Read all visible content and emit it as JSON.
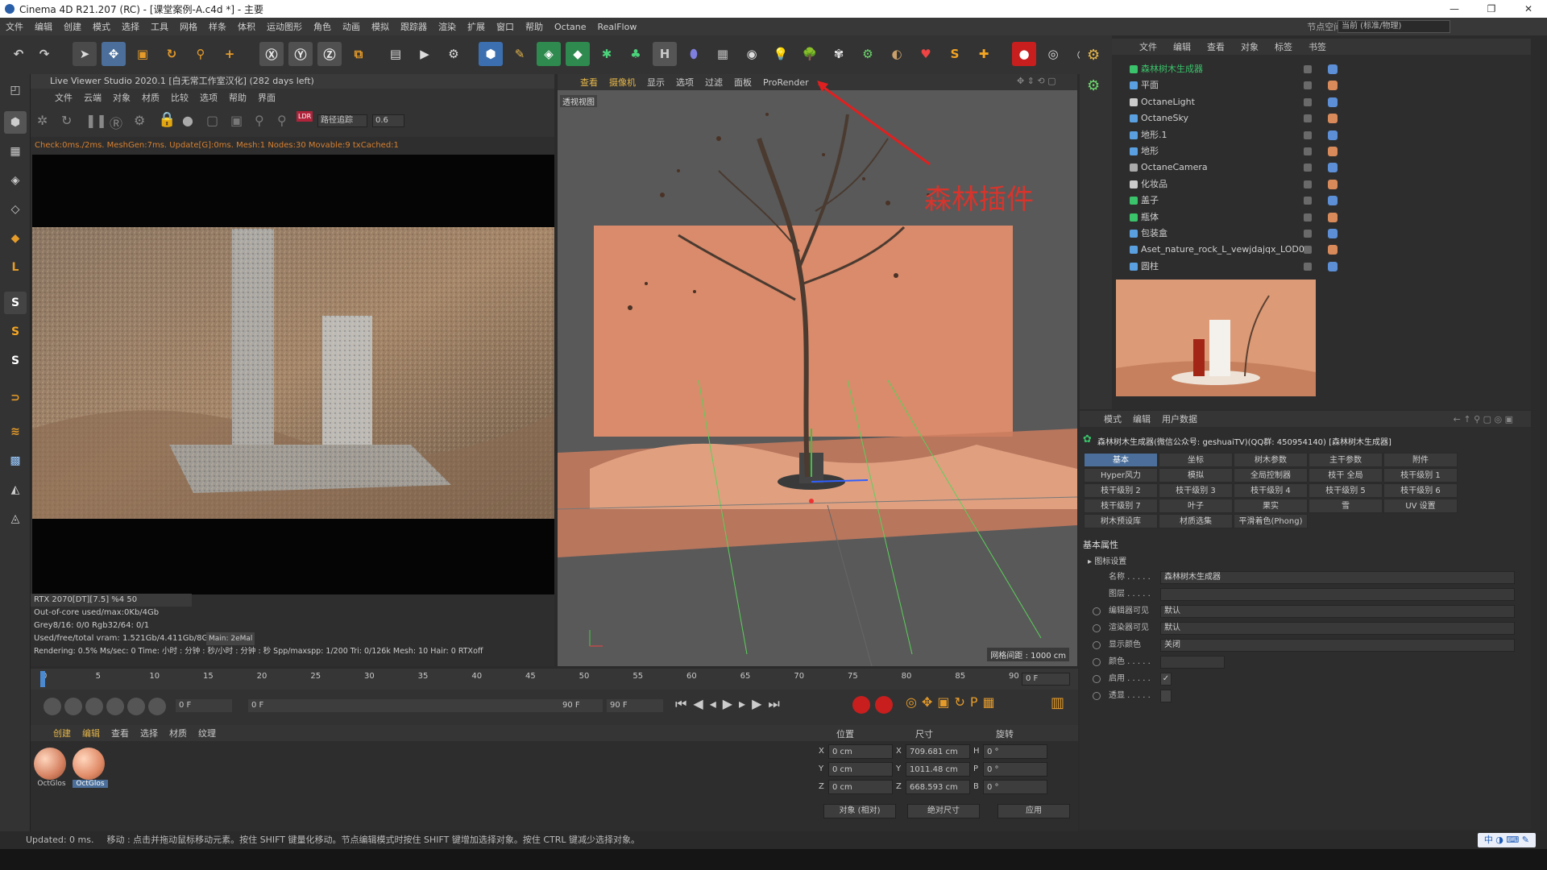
{
  "window": {
    "title": "Cinema 4D R21.207 (RC) - [课堂案例-A.c4d *] - 主要",
    "controls": [
      "—",
      "❐",
      "✕"
    ]
  },
  "menubar": {
    "items": [
      "文件",
      "编辑",
      "创建",
      "模式",
      "选择",
      "工具",
      "网格",
      "样条",
      "体积",
      "运动图形",
      "角色",
      "动画",
      "模拟",
      "跟踪器",
      "渲染",
      "扩展",
      "窗口",
      "帮助",
      "Octane",
      "RealFlow"
    ],
    "node_space_label": "节点空间:",
    "node_space_value": "当前 (标准/物理)"
  },
  "live_viewer": {
    "header": "Live Viewer Studio 2020.1 [白无常工作室汉化] (282 days left)",
    "menu": [
      "文件",
      "云端",
      "对象",
      "材质",
      "比较",
      "选项",
      "帮助",
      "界面"
    ],
    "mode": "路径追踪",
    "value": "0.6",
    "status": "Check:0ms./2ms. MeshGen:7ms. Update[G]:0ms. Mesh:1 Nodes:30 Movable:9 txCached:1",
    "stats": [
      "RTX 2070[DT][7.5]        %4      50",
      "Out-of-core used/max:0Kb/4Gb",
      "Grey8/16: 0/0          Rgb32/64: 0/1",
      "Used/free/total vram: 1.521Gb/4.411Gb/8G",
      "Rendering: 0.5%   Ms/sec: 0   Time: 小时 : 分钟 : 秒/小时 : 分钟 : 秒   Spp/maxspp: 1/200   Tri: 0/126k   Mesh: 10   Hair: 0   RTXoff"
    ],
    "main_tag": "Main: 2eMal"
  },
  "viewport": {
    "menu": [
      "查看",
      "摄像机",
      "显示",
      "选项",
      "过滤",
      "面板",
      "ProRender"
    ],
    "label": "透视视图",
    "annotation": "森林插件",
    "grid_info": "网格间距 : 1000 cm"
  },
  "object_manager": {
    "menu": [
      "文件",
      "编辑",
      "查看",
      "对象",
      "标签",
      "书签"
    ],
    "objects": [
      {
        "name": "森林树木生成器",
        "color": "#3ac36a",
        "highlight": true
      },
      {
        "name": "平面",
        "color": "#5aa0e0"
      },
      {
        "name": "OctaneLight",
        "color": "#cccccc"
      },
      {
        "name": "OctaneSky",
        "color": "#5aa0e0"
      },
      {
        "name": "地形.1",
        "color": "#5aa0e0"
      },
      {
        "name": "地形",
        "color": "#5aa0e0"
      },
      {
        "name": "OctaneCamera",
        "color": "#aaaaaa"
      },
      {
        "name": "化妆品",
        "color": "#cccccc"
      },
      {
        "name": "盖子",
        "color": "#3ac36a"
      },
      {
        "name": "瓶体",
        "color": "#3ac36a"
      },
      {
        "name": "包装盒",
        "color": "#5aa0e0"
      },
      {
        "name": "Aset_nature_rock_L_vewjdajqx_LOD0",
        "color": "#5aa0e0"
      },
      {
        "name": "圆柱",
        "color": "#5aa0e0"
      }
    ]
  },
  "attributes": {
    "menu": [
      "模式",
      "编辑",
      "用户数据"
    ],
    "object_title": "森林树木生成器(微信公众号: geshuaiTV)(QQ群: 450954140) [森林树木生成器]",
    "tabs": [
      "基本",
      "坐标",
      "树木参数",
      "主干参数",
      "附件",
      "Hyper风力",
      "模拟",
      "全局控制器",
      "枝干 全局",
      "枝干级别 1",
      "枝干级别 2",
      "枝干级别 3",
      "枝干级别 4",
      "枝干级别 5",
      "枝干级别 6",
      "枝干级别 7",
      "叶子",
      "果实",
      "雪",
      "UV 设置",
      "树木预设库",
      "材质选集",
      "平滑着色(Phong)"
    ],
    "section": "基本属性",
    "subsection": "图标设置",
    "fields": [
      {
        "label": "名称 . . . . .",
        "value": "森林树木生成器"
      },
      {
        "label": "图层 . . . . .",
        "value": ""
      },
      {
        "label": "编辑器可见",
        "value": "默认"
      },
      {
        "label": "渲染器可见",
        "value": "默认"
      },
      {
        "label": "显示颜色",
        "value": "关闭"
      },
      {
        "label": "颜色 . . . . .",
        "value": ""
      },
      {
        "label": "启用 . . . . .",
        "value": "✓"
      },
      {
        "label": "透显 . . . . .",
        "value": ""
      }
    ]
  },
  "timeline": {
    "ticks": [
      "0",
      "5",
      "10",
      "15",
      "20",
      "25",
      "30",
      "35",
      "40",
      "45",
      "50",
      "55",
      "60",
      "65",
      "70",
      "75",
      "80",
      "85",
      "90"
    ],
    "frame_display": "0 F"
  },
  "transport": {
    "start": "0 F",
    "current": "0 F",
    "end": "90 F",
    "end2": "90 F"
  },
  "materials": {
    "menu": [
      "创建",
      "编辑",
      "查看",
      "选择",
      "材质",
      "纹理"
    ],
    "items": [
      "OctGlos",
      "OctGlos"
    ]
  },
  "coordinates": {
    "headers": [
      "位置",
      "尺寸",
      "旋转"
    ],
    "rows": [
      {
        "axis": "X",
        "pos": "0 cm",
        "size_axis": "X",
        "size": "709.681 cm",
        "rot_axis": "H",
        "rot": "0 °"
      },
      {
        "axis": "Y",
        "pos": "0 cm",
        "size_axis": "Y",
        "size": "1011.48 cm",
        "rot_axis": "P",
        "rot": "0 °"
      },
      {
        "axis": "Z",
        "pos": "0 cm",
        "size_axis": "Z",
        "size": "668.593 cm",
        "rot_axis": "B",
        "rot": "0 °"
      }
    ],
    "mode1": "对象 (相对)",
    "mode2": "绝对尺寸",
    "apply": "应用"
  },
  "status": {
    "updated": "Updated: 0 ms.",
    "hint": "移动 : 点击并拖动鼠标移动元素。按住 SHIFT 键量化移动。节点编辑模式时按住 SHIFT 键增加选择对象。按住 CTRL 键减少选择对象。"
  },
  "ime": {
    "label": "中"
  }
}
